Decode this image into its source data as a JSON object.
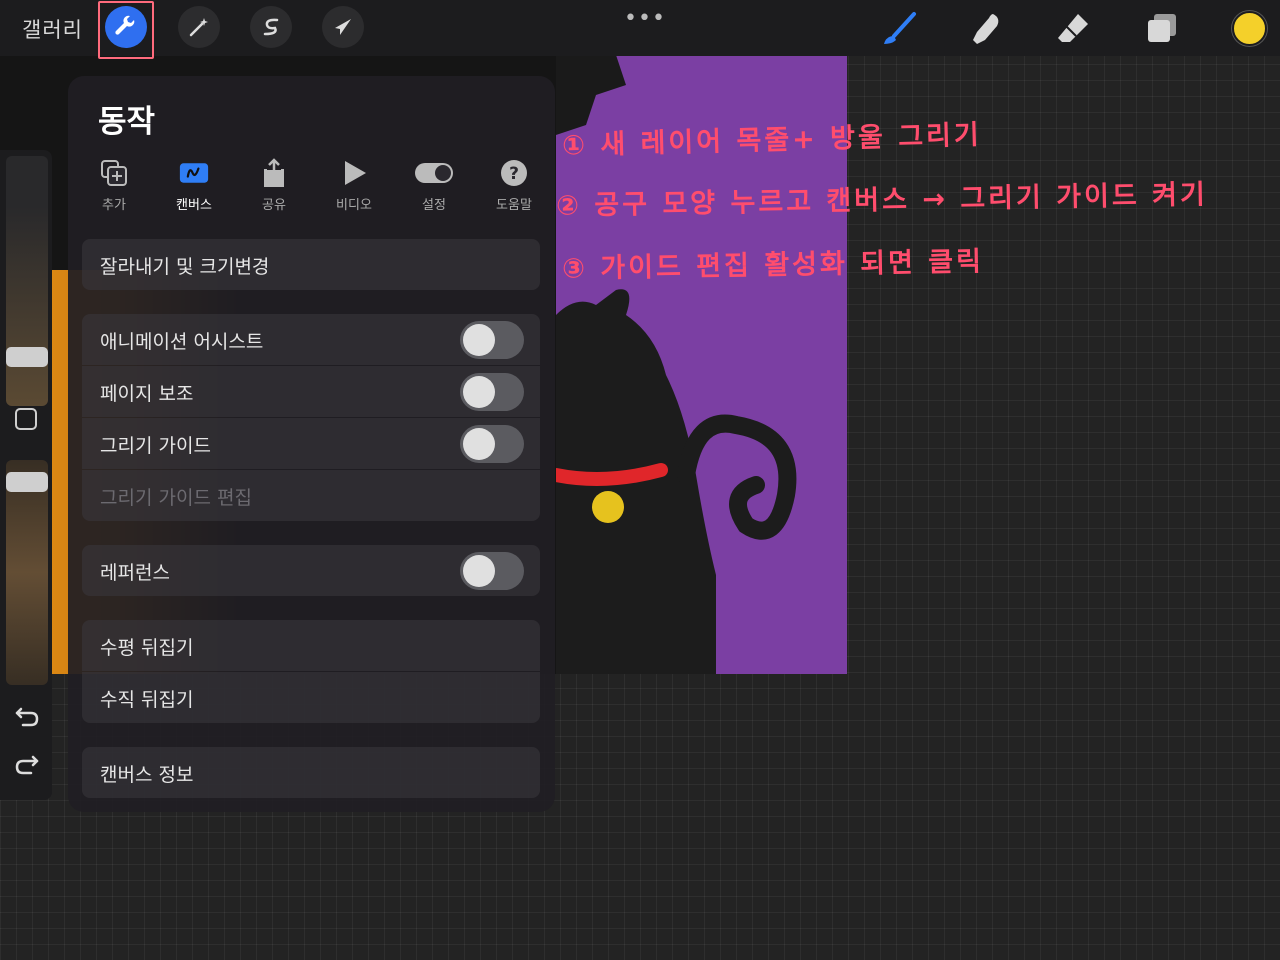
{
  "topbar": {
    "gallery_label": "갤러리",
    "more_label": "•••",
    "tools": [
      "actions",
      "adjustments",
      "selection",
      "transform",
      "brush",
      "smudge",
      "eraser",
      "layers"
    ],
    "current_color": "#f4d02a",
    "accent": "#2f6ff0"
  },
  "popover": {
    "title": "동작",
    "tabs": [
      {
        "label": "추가",
        "icon": "add-icon"
      },
      {
        "label": "캔버스",
        "icon": "canvas-icon",
        "active": true
      },
      {
        "label": "공유",
        "icon": "share-icon"
      },
      {
        "label": "비디오",
        "icon": "video-icon"
      },
      {
        "label": "설정",
        "icon": "prefs-toggle-icon"
      },
      {
        "label": "도움말",
        "icon": "help-icon"
      }
    ],
    "rows": {
      "crop": "잘라내기 및 크기변경",
      "animation": "애니메이션 어시스트",
      "page": "페이지 보조",
      "guide": "그리기 가이드",
      "guide_edit": "그리기 가이드 편집",
      "reference": "레퍼런스",
      "flip_h": "수평 뒤집기",
      "flip_v": "수직 뒤집기",
      "info": "캔버스 정보"
    }
  },
  "annotations": {
    "note1": "① 새 레이어 목줄+ 방울 그리기",
    "note2": "② 공구 모양 누르고 캔버스 → 그리기 가이드 켜기",
    "note3": "③ 가이드 편집 활성화 되면  클릭",
    "color": "#ff4d6d"
  }
}
